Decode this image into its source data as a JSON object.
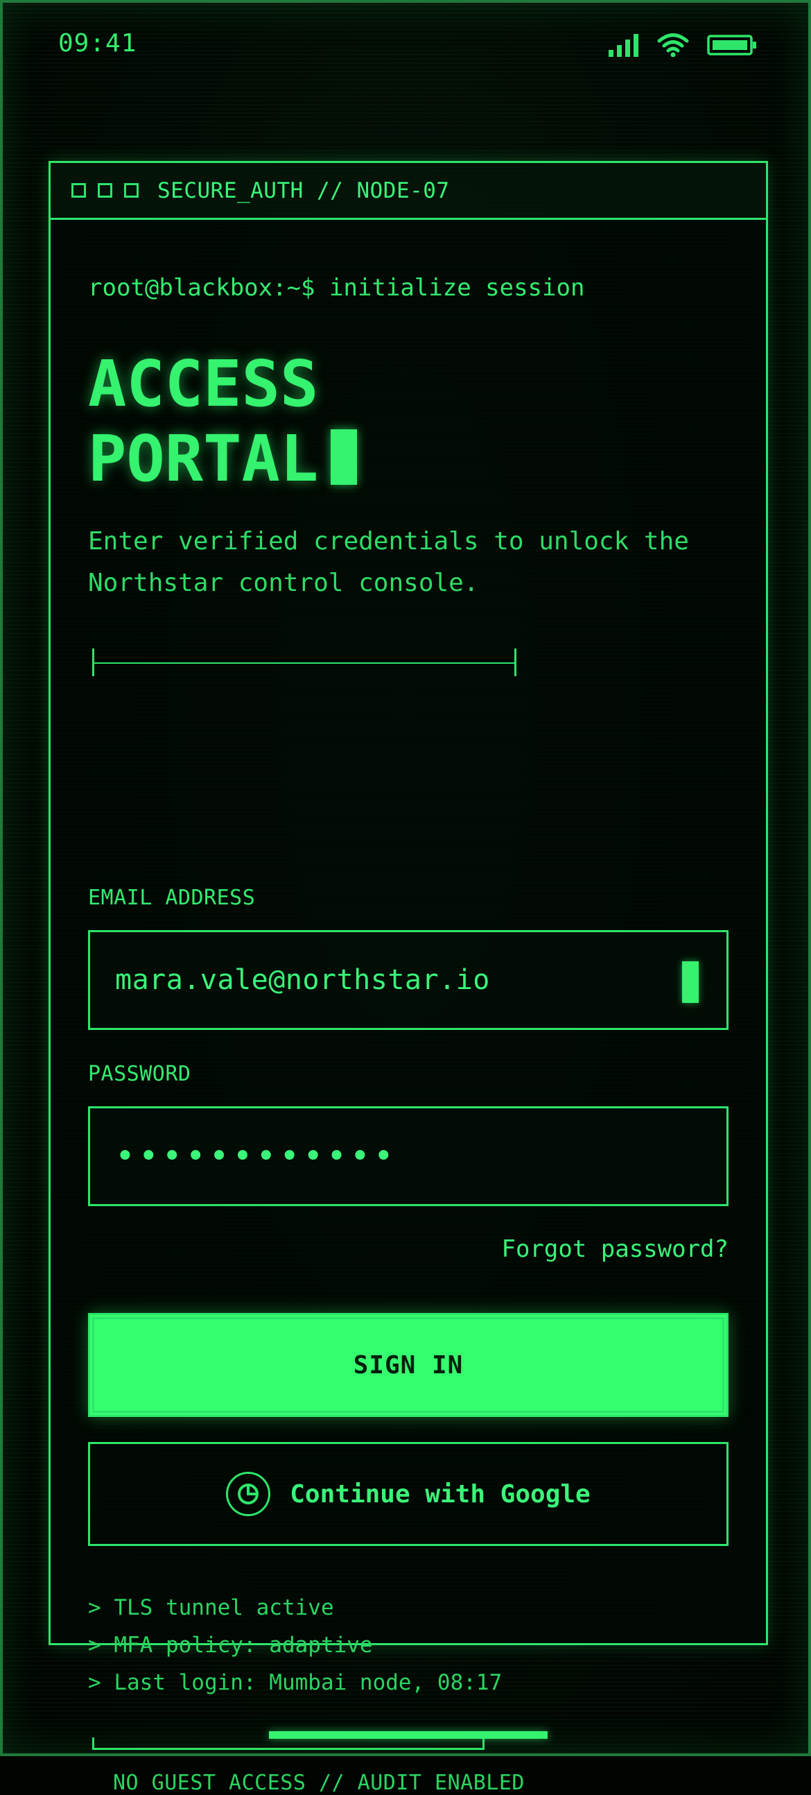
{
  "status_bar": {
    "time": "09:41",
    "icons": [
      "cellular-signal-icon",
      "wifi-icon",
      "battery-icon"
    ]
  },
  "window": {
    "title": "SECURE_AUTH // NODE-07",
    "controls": [
      "window-control-1",
      "window-control-2",
      "window-control-3"
    ]
  },
  "prompt": "root@blackbox:~$ initialize session",
  "headline": {
    "line1": "ACCESS",
    "line2": "PORTAL"
  },
  "subtitle": "Enter verified credentials to unlock the Northstar control console.",
  "form": {
    "email_label": "EMAIL ADDRESS",
    "email_value": "mara.vale@northstar.io",
    "password_label": "PASSWORD",
    "password_value": "••••••••••••",
    "forgot_link": "Forgot password?",
    "sign_in": "SIGN IN",
    "google": "Continue with Google"
  },
  "log": [
    "> TLS tunnel active",
    "> MFA policy: adaptive",
    "> Last login: Mumbai node, 08:17"
  ],
  "footer_note": "NO GUEST ACCESS // AUDIT ENABLED",
  "colors": {
    "accent": "#33ff6f",
    "text": "#2ee56a",
    "background": "#010501"
  }
}
